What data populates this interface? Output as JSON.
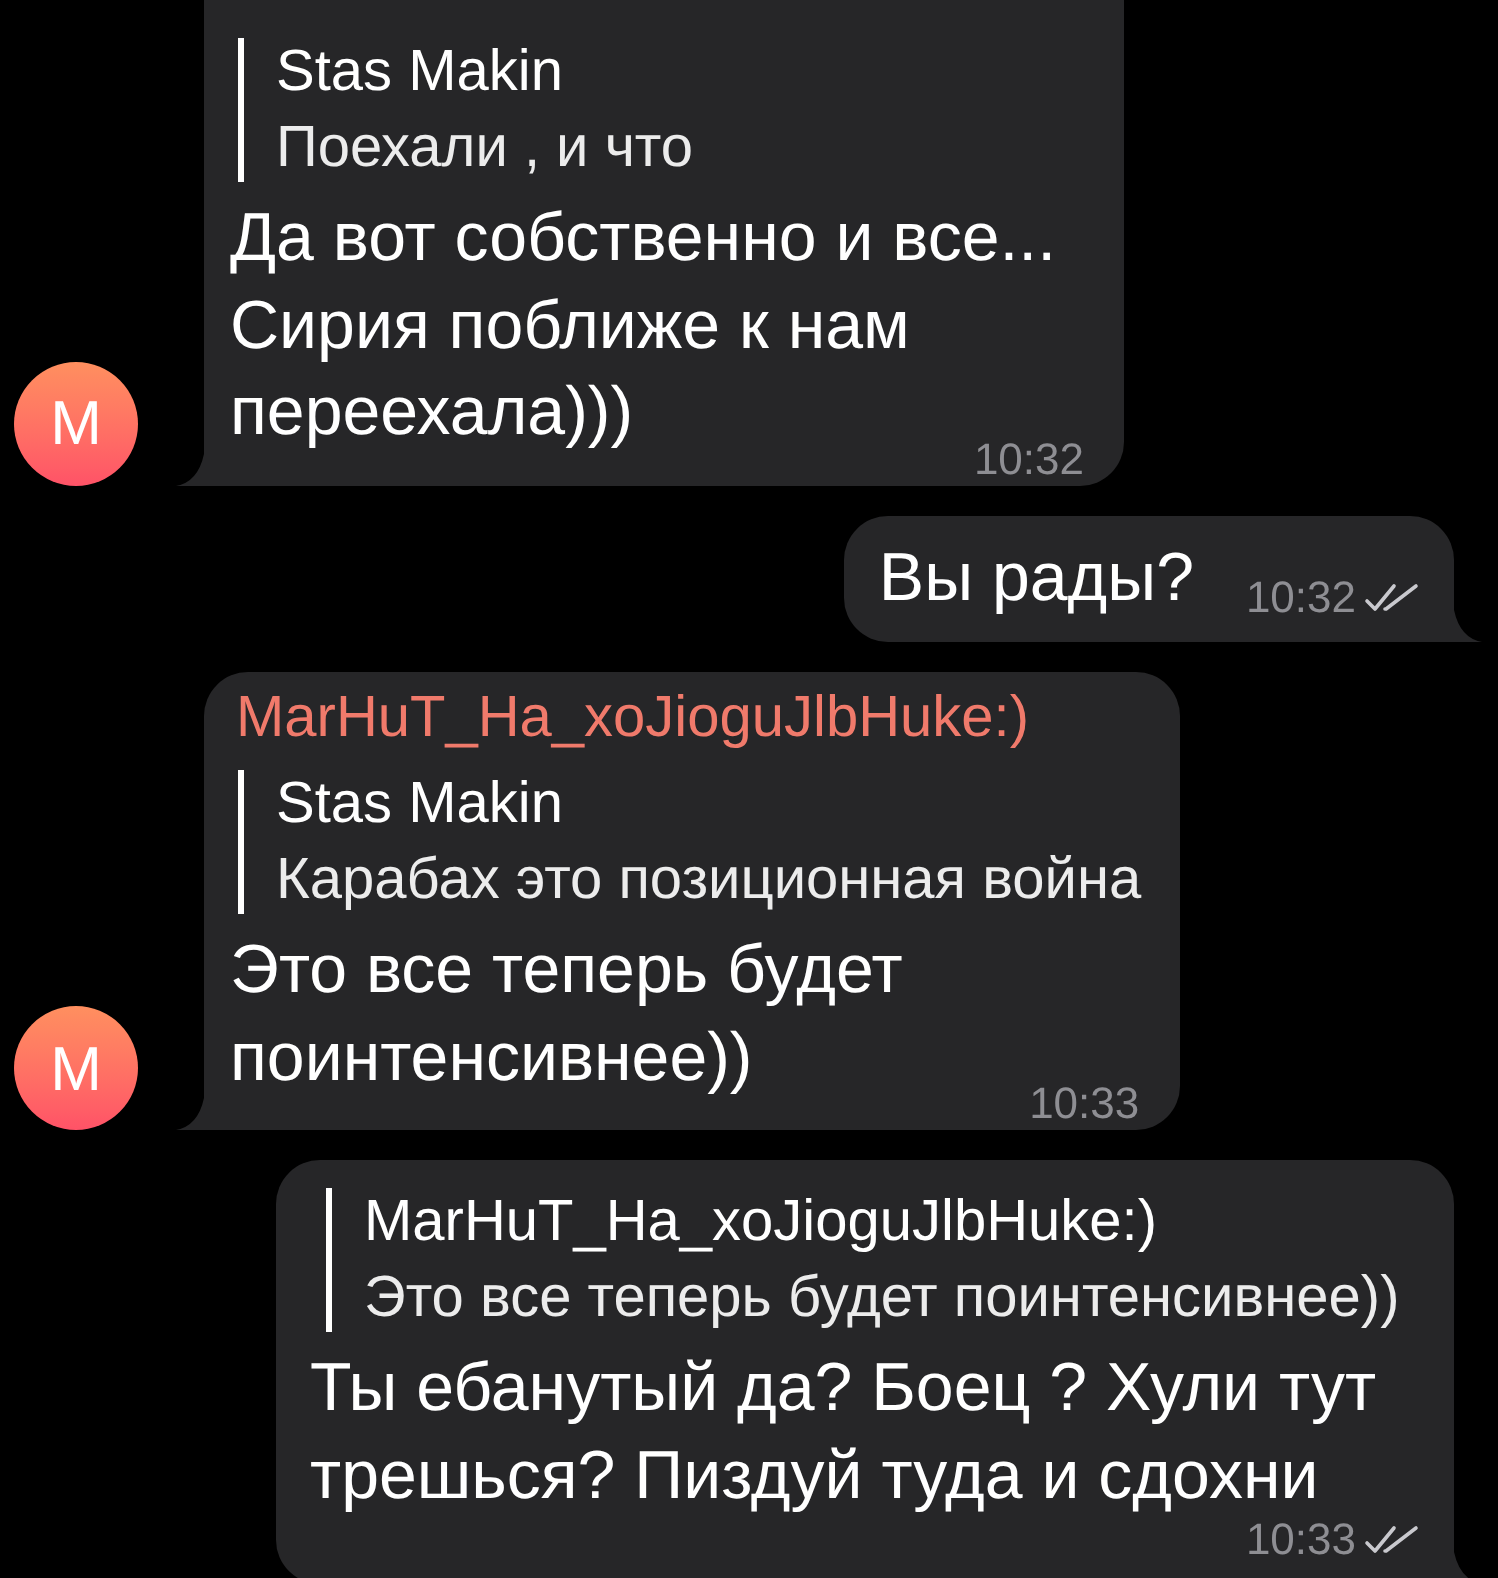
{
  "messages": [
    {
      "kind": "incoming",
      "avatar": "M",
      "reply": {
        "author": "Stas Makin",
        "text": "Поехали , и что"
      },
      "text": "Да вот собственно и все... Сирия поближе к нам переехала)))",
      "time": "10:32"
    },
    {
      "kind": "outgoing",
      "text": "Вы рады?",
      "time": "10:32",
      "read": true
    },
    {
      "kind": "incoming",
      "avatar": "M",
      "sender": "MarHuT_Ha_xoJioguJlbHuke:)",
      "reply": {
        "author": "Stas Makin",
        "text": "Карабах это позиционная война"
      },
      "text": "Это все теперь будет поинтенсивнее))",
      "time": "10:33"
    },
    {
      "kind": "outgoing",
      "reply": {
        "author": "MarHuT_Ha_xoJioguJlbHuke:)",
        "text": "Это все теперь будет поинтенсивнее))"
      },
      "text": "Ты ебанутый да? Боец ? Хули тут трешься? Пиздуй туда и сдохни",
      "time": "10:33",
      "read": true
    }
  ]
}
